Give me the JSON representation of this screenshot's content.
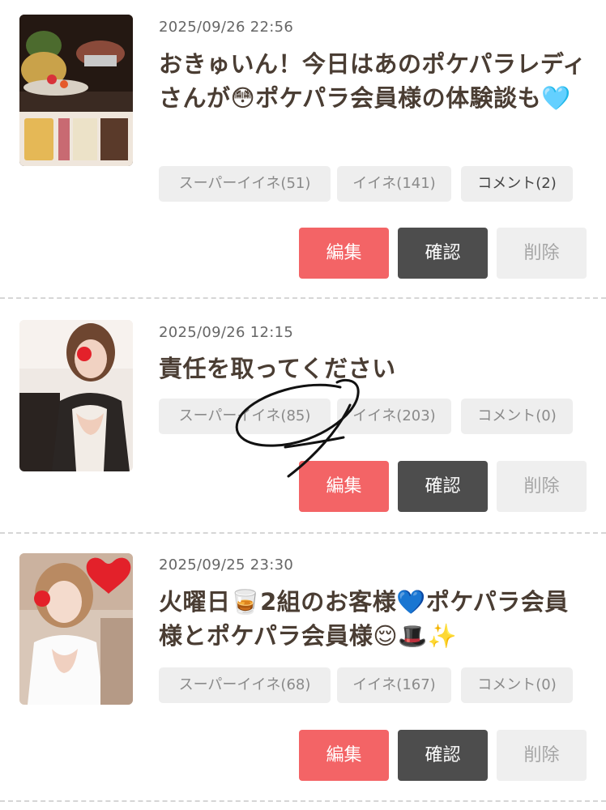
{
  "posts": [
    {
      "date": "2025/09/26 22:56",
      "title": "おきゅいん！今日はあのポケパラレディさんが😳ポケパラ会員様の体験談も🩵",
      "chips": {
        "super_like": "スーパーイイネ(51)",
        "like": "イイネ(141)",
        "comment": "コメント(2)"
      },
      "buttons": {
        "edit": "編集",
        "check": "確認",
        "delete": "削除"
      }
    },
    {
      "date": "2025/09/26 12:15",
      "title": "責任を取ってください",
      "chips": {
        "super_like": "スーパーイイネ(85)",
        "like": "イイネ(203)",
        "comment": "コメント(0)"
      },
      "buttons": {
        "edit": "編集",
        "check": "確認",
        "delete": "削除"
      }
    },
    {
      "date": "2025/09/25 23:30",
      "title": "火曜日🥃2組のお客様💙ポケパラ会員様とポケパラ会員様😌🎩✨",
      "chips": {
        "super_like": "スーパーイイネ(68)",
        "like": "イイネ(167)",
        "comment": "コメント(0)"
      },
      "buttons": {
        "edit": "編集",
        "check": "確認",
        "delete": "削除"
      }
    }
  ],
  "colors": {
    "edit_button": "#f36466",
    "check_button": "#4d4d4d",
    "delete_button": "#efefef",
    "chip_background": "#eeeeee",
    "title_text": "#4a3d33"
  },
  "icons": [
    "photo-thumbnail",
    "hand-drawn-scribble"
  ]
}
